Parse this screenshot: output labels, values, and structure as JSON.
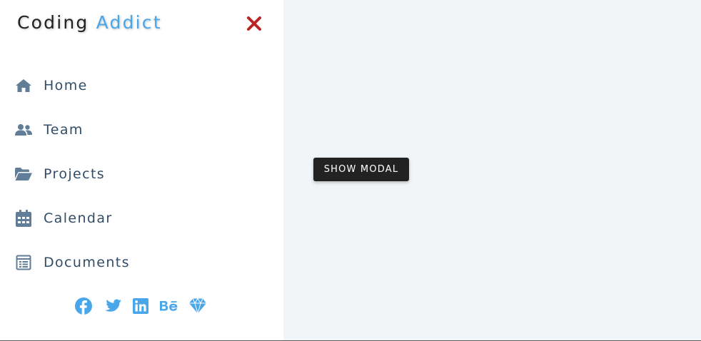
{
  "logo": {
    "part1": "Coding",
    "part2": "Addict"
  },
  "close_icon": "close-x-icon",
  "nav": {
    "items": [
      {
        "label": "Home",
        "icon": "home-icon"
      },
      {
        "label": "Team",
        "icon": "users-icon"
      },
      {
        "label": "Projects",
        "icon": "folder-open-icon"
      },
      {
        "label": "Calendar",
        "icon": "calendar-icon"
      },
      {
        "label": "Documents",
        "icon": "documents-icon"
      }
    ]
  },
  "social": [
    {
      "icon": "facebook-icon"
    },
    {
      "icon": "twitter-icon"
    },
    {
      "icon": "linkedin-icon"
    },
    {
      "icon": "behance-icon"
    },
    {
      "icon": "sketch-icon"
    }
  ],
  "main": {
    "show_modal_label": "show modal"
  },
  "colors": {
    "accent": "#49a6e9",
    "nav_text": "#324d67",
    "close": "#bb2525",
    "sidebar_bg": "#ffffff",
    "main_bg": "#f1f5f8",
    "button_bg": "#222222"
  }
}
